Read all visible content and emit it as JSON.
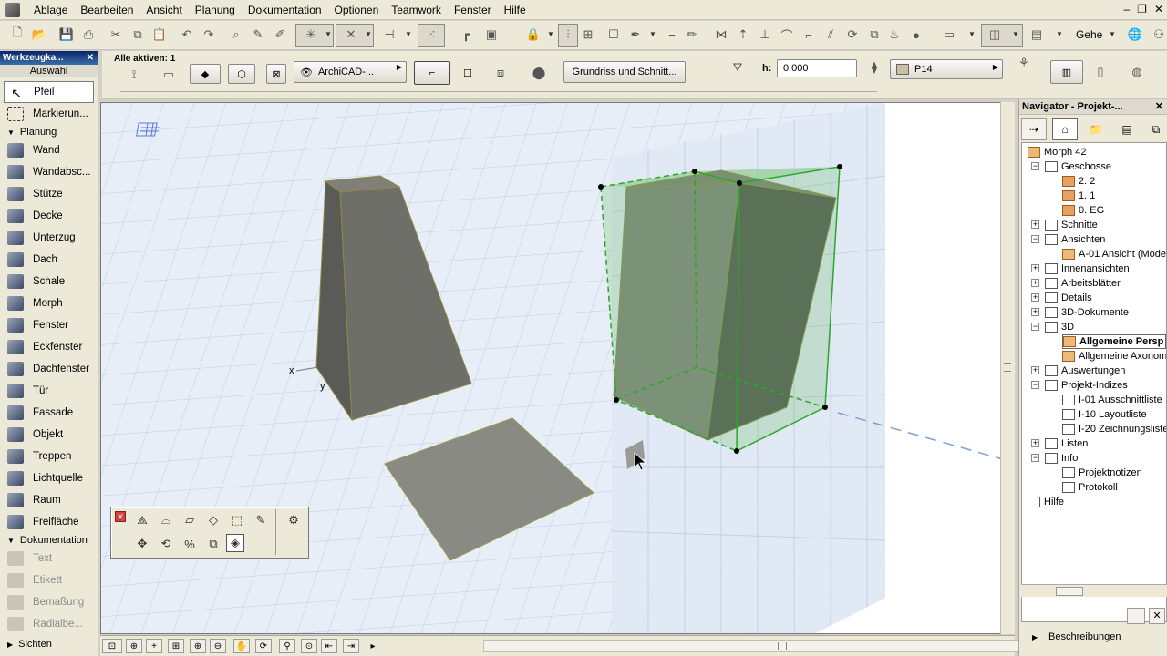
{
  "menu": {
    "items": [
      "Ablage",
      "Bearbeiten",
      "Ansicht",
      "Planung",
      "Dokumentation",
      "Optionen",
      "Teamwork",
      "Fenster",
      "Hilfe"
    ]
  },
  "toolbar": {
    "view_label": "Gehe"
  },
  "infobox": {
    "active_label": "Alle aktiven: 1",
    "layer_label": "ArchiCAD-...",
    "floorplan_button": "Grundriss und Schnitt...",
    "h_label": "h:",
    "h_value": "0.000",
    "material_label": "P14"
  },
  "toolbox": {
    "title": "Werkzeugka...",
    "selection_section": "Auswahl",
    "selection_tools": [
      {
        "label": "Pfeil",
        "icon": "arrow-icon"
      },
      {
        "label": "Markierun...",
        "icon": "marquee-icon"
      }
    ],
    "design_category": "Planung",
    "design_tools": [
      {
        "label": "Wand",
        "icon": "wall-icon"
      },
      {
        "label": "Wandabsc...",
        "icon": "wall-end-icon"
      },
      {
        "label": "Stütze",
        "icon": "column-icon"
      },
      {
        "label": "Decke",
        "icon": "slab-icon"
      },
      {
        "label": "Unterzug",
        "icon": "beam-icon"
      },
      {
        "label": "Dach",
        "icon": "roof-icon"
      },
      {
        "label": "Schale",
        "icon": "shell-icon"
      },
      {
        "label": "Morph",
        "icon": "morph-icon"
      },
      {
        "label": "Fenster",
        "icon": "window-icon"
      },
      {
        "label": "Eckfenster",
        "icon": "corner-window-icon"
      },
      {
        "label": "Dachfenster",
        "icon": "skylight-icon"
      },
      {
        "label": "Tür",
        "icon": "door-icon"
      },
      {
        "label": "Fassade",
        "icon": "curtain-wall-icon"
      },
      {
        "label": "Objekt",
        "icon": "object-icon"
      },
      {
        "label": "Treppen",
        "icon": "stair-icon"
      },
      {
        "label": "Lichtquelle",
        "icon": "lamp-icon"
      },
      {
        "label": "Raum",
        "icon": "zone-icon"
      },
      {
        "label": "Freifläche",
        "icon": "mesh-icon"
      }
    ],
    "doc_category": "Dokumentation",
    "doc_tools": [
      {
        "label": "Text",
        "icon": "text-icon"
      },
      {
        "label": "Etikett",
        "icon": "label-icon"
      },
      {
        "label": "Bemaßung",
        "icon": "dimension-icon"
      },
      {
        "label": "Radialbe...",
        "icon": "radial-dimension-icon"
      }
    ],
    "views_category": "Sichten"
  },
  "viewport": {
    "axis_x": "x",
    "axis_y": "y"
  },
  "navigator": {
    "title": "Navigator - Projekt-...",
    "tree": [
      {
        "label": "Morph 42",
        "level": 0,
        "icon": "house",
        "bold": false
      },
      {
        "label": "Geschosse",
        "level": 1,
        "icon": "doc",
        "bold": false
      },
      {
        "label": "2. 2",
        "level": 2,
        "icon": "folder",
        "bold": false
      },
      {
        "label": "1. 1",
        "level": 2,
        "icon": "folder",
        "bold": false
      },
      {
        "label": "0. EG",
        "level": 2,
        "icon": "folder",
        "bold": false
      },
      {
        "label": "Schnitte",
        "level": 1,
        "icon": "doc",
        "bold": false
      },
      {
        "label": "Ansichten",
        "level": 1,
        "icon": "doc",
        "bold": false
      },
      {
        "label": "A-01 Ansicht (Mode",
        "level": 2,
        "icon": "house",
        "bold": false
      },
      {
        "label": "Innenansichten",
        "level": 1,
        "icon": "doc",
        "bold": false
      },
      {
        "label": "Arbeitsblätter",
        "level": 1,
        "icon": "doc",
        "bold": false
      },
      {
        "label": "Details",
        "level": 1,
        "icon": "doc",
        "bold": false
      },
      {
        "label": "3D-Dokumente",
        "level": 1,
        "icon": "doc",
        "bold": false
      },
      {
        "label": "3D",
        "level": 1,
        "icon": "doc",
        "bold": false
      },
      {
        "label": "Allgemeine Persp",
        "level": 2,
        "icon": "house",
        "bold": true
      },
      {
        "label": "Allgemeine Axonom",
        "level": 2,
        "icon": "house",
        "bold": false
      },
      {
        "label": "Auswertungen",
        "level": 1,
        "icon": "doc",
        "bold": false
      },
      {
        "label": "Projekt-Indizes",
        "level": 1,
        "icon": "doc",
        "bold": false
      },
      {
        "label": "I-01 Ausschnittliste",
        "level": 2,
        "icon": "doc",
        "bold": false
      },
      {
        "label": "I-10 Layoutliste",
        "level": 2,
        "icon": "doc",
        "bold": false
      },
      {
        "label": "I-20 Zeichnungsliste",
        "level": 2,
        "icon": "doc",
        "bold": false
      },
      {
        "label": "Listen",
        "level": 1,
        "icon": "doc",
        "bold": false
      },
      {
        "label": "Info",
        "level": 1,
        "icon": "doc",
        "bold": false
      },
      {
        "label": "Projektnotizen",
        "level": 2,
        "icon": "doc",
        "bold": false
      },
      {
        "label": "Protokoll",
        "level": 2,
        "icon": "doc",
        "bold": false
      },
      {
        "label": "Hilfe",
        "level": 0,
        "icon": "doc",
        "bold": false
      }
    ],
    "footer_label": "Beschreibungen"
  },
  "colors": {
    "selection_green": "#2aa82a",
    "morph_gray": "#6f6f6a",
    "grid_blue": "#b8c8e0"
  }
}
